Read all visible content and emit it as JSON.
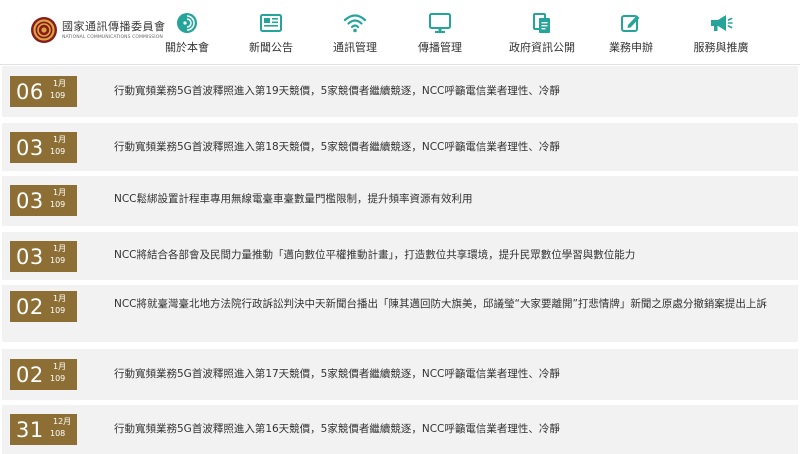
{
  "header": {
    "logo_title": "國家通訊傳播委員會",
    "logo_subtitle": "NATIONAL COMMUNICATIONS COMMISSION",
    "nav": [
      {
        "label": "關於本會",
        "icon": "about-icon"
      },
      {
        "label": "新聞公告",
        "icon": "news-icon"
      },
      {
        "label": "通訊管理",
        "icon": "wifi-icon"
      },
      {
        "label": "傳播管理",
        "icon": "monitor-icon"
      },
      {
        "label": "政府資訊公開",
        "icon": "document-icon"
      },
      {
        "label": "業務申辦",
        "icon": "edit-icon"
      },
      {
        "label": "服務與推廣",
        "icon": "megaphone-icon"
      }
    ]
  },
  "colors": {
    "accent": "#8d6f35",
    "nav_icon": "#25a59a",
    "row_background": "#f2f2f2"
  },
  "news": [
    {
      "day": "06",
      "month": "1月",
      "year": "109",
      "title": "行動寬頻業務5G首波釋照進入第19天競價，5家競價者繼續競逐，NCC呼籲電信業者理性、冷靜"
    },
    {
      "day": "03",
      "month": "1月",
      "year": "109",
      "title": "行動寬頻業務5G首波釋照進入第18天競價，5家競價者繼續競逐，NCC呼籲電信業者理性、冷靜"
    },
    {
      "day": "03",
      "month": "1月",
      "year": "109",
      "title": "NCC鬆綁設置計程車專用無線電臺車臺數量門檻限制，提升頻率資源有效利用"
    },
    {
      "day": "03",
      "month": "1月",
      "year": "109",
      "title": "NCC將結合各部會及民間力量推動「邁向數位平權推動計畫」，打造數位共享環境，提升民眾數位學習與數位能力"
    },
    {
      "day": "02",
      "month": "1月",
      "year": "109",
      "title": "NCC將就臺灣臺北地方法院行政訴訟判決中天新聞台播出「陳其邁回防大旗美，邱議瑩“大家要離開”打悲情牌」新聞之原處分撤銷案提出上訴"
    },
    {
      "day": "02",
      "month": "1月",
      "year": "109",
      "title": "行動寬頻業務5G首波釋照進入第17天競價，5家競價者繼續競逐，NCC呼籲電信業者理性、冷靜"
    },
    {
      "day": "31",
      "month": "12月",
      "year": "108",
      "title": "行動寬頻業務5G首波釋照進入第16天競價，5家競價者繼續競逐，NCC呼籲電信業者理性、冷靜"
    }
  ]
}
